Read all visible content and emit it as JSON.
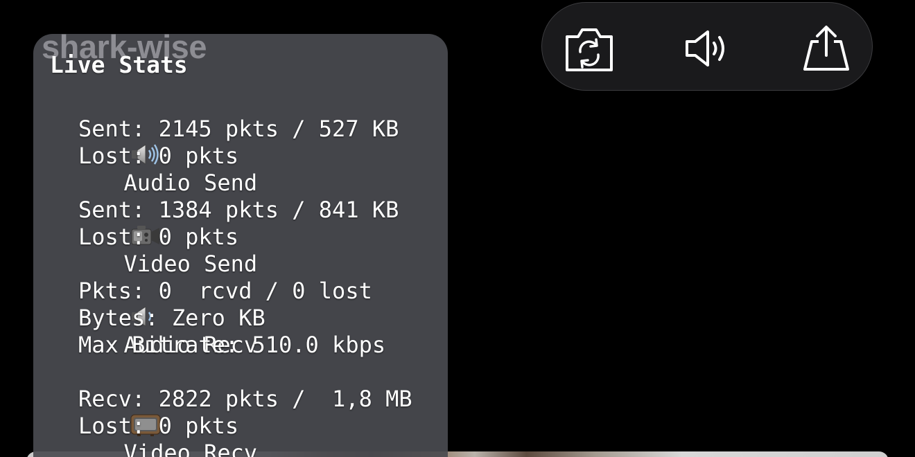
{
  "overlay": {
    "watermark": "shark-wise",
    "title": "Live Stats"
  },
  "stats": {
    "audio_send": {
      "icon": "speaker-loud-icon",
      "label": "Audio Send",
      "sent": "Sent: 2145 pkts / 527 KB",
      "lost": "Lost: 0 pkts"
    },
    "video_send": {
      "icon": "video-camera-icon",
      "label": "Video Send",
      "sent": "Sent: 1384 pkts / 841 KB",
      "lost": "Lost: 0 pkts"
    },
    "audio_recv": {
      "icon": "speaker-icon",
      "label": "Audio Recv",
      "pkts": "Pkts: 0  rcvd / 0 lost",
      "bytes": "Bytes: Zero KB",
      "max_bitrate": "Max Bitrate: 510.0 kbps"
    },
    "video_recv": {
      "icon": "television-icon",
      "label": "Video Recv",
      "recv": "Recv: 2822 pkts /  1,8 MB",
      "lost": "Lost: 0 pkts"
    }
  },
  "controls": {
    "buttons": [
      {
        "name": "switch-camera",
        "icon": "camera-rotate-icon"
      },
      {
        "name": "speaker",
        "icon": "speaker-volume-icon"
      },
      {
        "name": "share",
        "icon": "share-icon"
      }
    ],
    "icon_color": "#ffffff",
    "bar_color": "#1a1a1c"
  },
  "colors": {
    "background": "#000000",
    "panel": "#4a4b50",
    "text": "#ffffff"
  }
}
